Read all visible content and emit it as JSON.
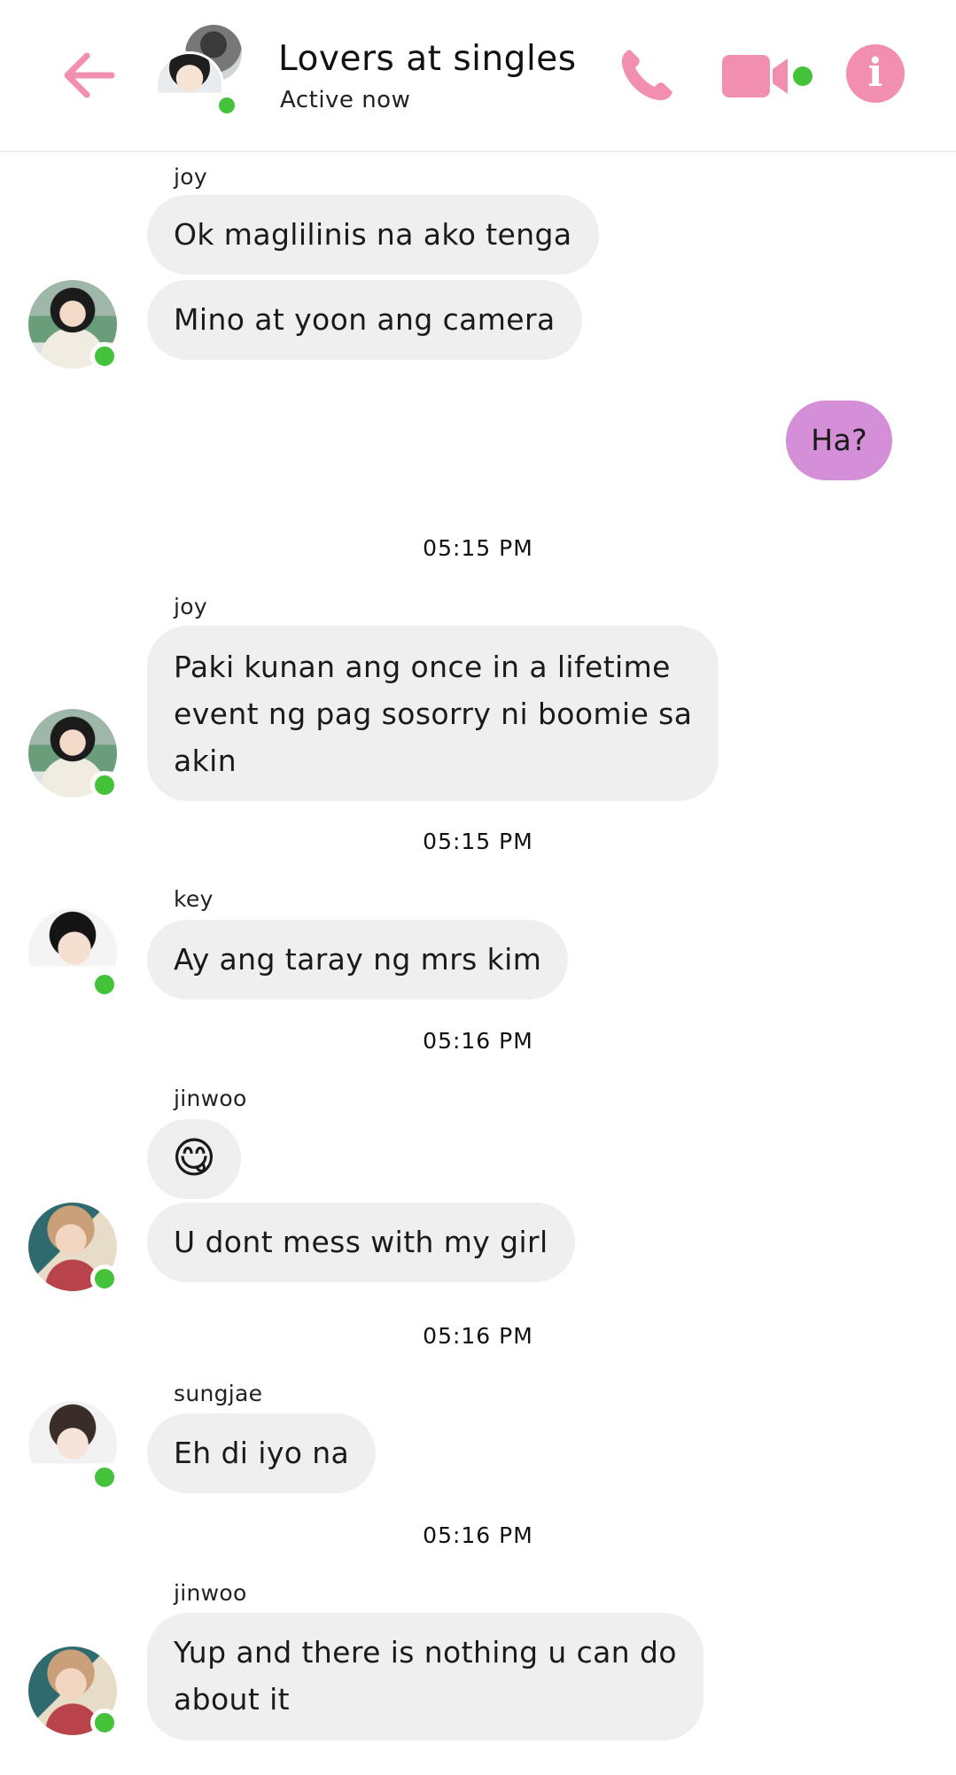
{
  "header": {
    "title": "Lovers at singles",
    "subtitle": "Active now",
    "icons": [
      "back-arrow-icon",
      "phone-icon",
      "video-camera-icon",
      "info-icon"
    ],
    "accent_color": "#f28fb0",
    "online_color": "#44c23a"
  },
  "messages": [
    {
      "sender": "joy",
      "lines": [
        "Ok maglilinis na ako tenga",
        "Mino at yoon ang camera"
      ]
    },
    {
      "outgoing": "Ha?"
    },
    {
      "timestamp": "05:15 PM"
    },
    {
      "sender": "joy",
      "lines": [
        "Paki kunan ang once in a lifetime\nevent ng pag sosorry ni boomie sa\nakin"
      ]
    },
    {
      "timestamp": "05:15 PM"
    },
    {
      "sender": "key",
      "lines": [
        "Ay ang taray ng mrs kim"
      ]
    },
    {
      "timestamp": "05:16 PM"
    },
    {
      "sender": "jinwoo",
      "lines": [
        "😋",
        "U dont mess with my girl"
      ]
    },
    {
      "timestamp": "05:16 PM"
    },
    {
      "sender": "sungjae",
      "lines": [
        "Eh di iyo na"
      ]
    },
    {
      "timestamp": "05:16 PM"
    },
    {
      "sender": "jinwoo",
      "lines": [
        "Yup and there is nothing u can do\nabout it"
      ]
    }
  ]
}
